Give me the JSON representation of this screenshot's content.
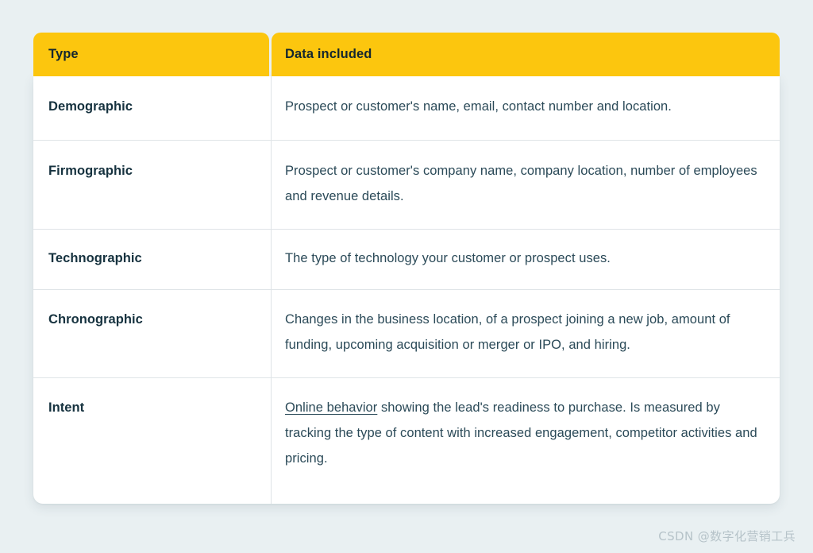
{
  "page": {
    "background_color": "#e9f0f2"
  },
  "table": {
    "header_background": "#fcc60e",
    "header_text_color": "#13262f",
    "body_background": "#ffffff",
    "body_text_color": "#2b4a58",
    "type_text_color": "#16323f",
    "grid_line_color": "#dfe4e7",
    "columns": [
      {
        "label": "Type"
      },
      {
        "label": "Data included"
      }
    ],
    "rows": [
      {
        "type": "Demographic",
        "data": "Prospect or customer's name, email, contact number and location."
      },
      {
        "type": "Firmographic",
        "data": "Prospect or customer's company name, company location, number of employees and revenue details."
      },
      {
        "type": "Technographic",
        "data": "The type of technology your customer or prospect uses."
      },
      {
        "type": "Chronographic",
        "data": "Changes in the business location, of a prospect joining a new job, amount of funding, upcoming acquisition or merger or IPO, and hiring."
      },
      {
        "type": "Intent",
        "link_text": "Online behavior",
        "data": " showing the lead's readiness to purchase. Is measured by tracking the type of content with increased engagement, competitor activities and pricing."
      }
    ]
  },
  "watermark": {
    "text": "CSDN @数字化营销工兵"
  }
}
